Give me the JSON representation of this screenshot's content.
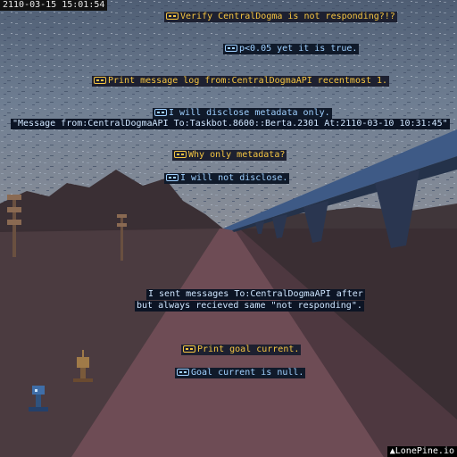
{
  "hud": {
    "timestamp": "2110-03-15 15:01:54"
  },
  "dialogue": [
    {
      "speaker": "human",
      "icon": "human-icon",
      "text": "Verify CentralDogma is not responding?!?"
    },
    {
      "speaker": "robot",
      "icon": "robot-icon",
      "text": "p<0.05 yet it is true."
    },
    {
      "speaker": "human",
      "icon": "human-icon",
      "text": "Print message log from:CentralDogmaAPI recentmost 1."
    },
    {
      "speaker": "robot",
      "icon": "robot-icon",
      "text": "I will disclose metadata only."
    },
    {
      "speaker": "log",
      "text": "\"Message from:CentralDogmaAPI To:Taskbot.8600::Berta.2301 At:2110-03-10 10:31:45\""
    },
    {
      "speaker": "human",
      "icon": "human-icon",
      "text": "Why only metadata?"
    },
    {
      "speaker": "robot",
      "icon": "robot-icon",
      "text": "I will not disclose."
    },
    {
      "speaker": "narration",
      "text": "I sent messages To:CentralDogmaAPI after"
    },
    {
      "speaker": "narration",
      "text": "but always recieved same \"not responding\"."
    },
    {
      "speaker": "human",
      "icon": "human-icon",
      "text": "Print goal current."
    },
    {
      "speaker": "robot",
      "icon": "robot-icon",
      "text": "Goal current is null."
    }
  ],
  "watermark": {
    "text": "LonePine.io",
    "icon": "pine-tree-icon"
  },
  "colors": {
    "question": "#f5c542",
    "answer": "#9fd0ff",
    "sky": "#5f6f86",
    "road": "#6b4a52"
  }
}
